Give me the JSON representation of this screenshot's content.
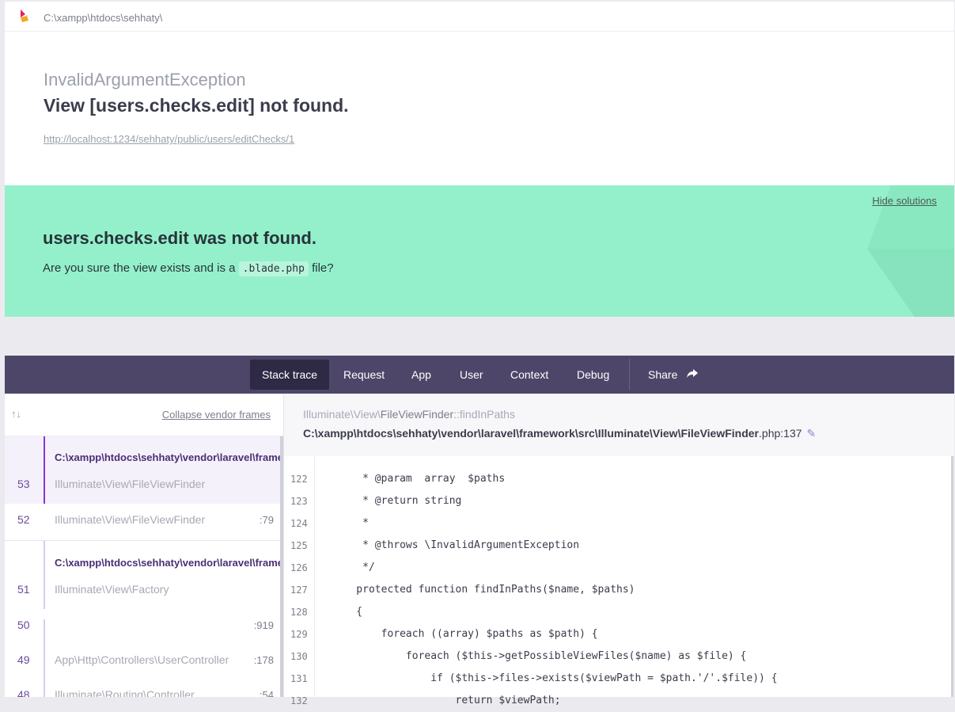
{
  "header": {
    "path": "C:\\xampp\\htdocs\\sehhaty\\"
  },
  "error": {
    "exception_class": "InvalidArgumentException",
    "message": "View [users.checks.edit] not found.",
    "url": "http://localhost:1234/sehhaty/public/users/editChecks/1"
  },
  "solution": {
    "hide_label": "Hide solutions",
    "title": "users.checks.edit was not found.",
    "desc_before": "Are you sure the view exists and is a",
    "desc_code": ".blade.php",
    "desc_after": "file?"
  },
  "tabs": [
    "Stack trace",
    "Request",
    "App",
    "User",
    "Context",
    "Debug",
    "Share"
  ],
  "frames_header": {
    "collapse_label": "Collapse vendor frames",
    "arrows": "↑↓"
  },
  "frames": [
    {
      "file": "C:\\xampp\\htdocs\\sehhaty\\vendor\\laravel\\framework\\src\\Illuminate\\View\\FileViewFinder.php",
      "num": "53",
      "cls": "Illuminate\\View\\FileViewFinder",
      "line": ""
    },
    {
      "file": "",
      "num": "52",
      "cls": "Illuminate\\View\\FileViewFinder",
      "line": ":79"
    },
    {
      "file": "C:\\xampp\\htdocs\\sehhaty\\vendor\\laravel\\framework\\src\\Illuminate\\View\\Factory.php",
      "num": "51",
      "cls": "Illuminate\\View\\Factory",
      "line": ""
    },
    {
      "file": "",
      "num": "50",
      "cls": "",
      "line": ":919"
    },
    {
      "file": "",
      "num": "49",
      "cls": "App\\Http\\Controllers\\UserController",
      "line": ":178"
    },
    {
      "file": "",
      "num": "48",
      "cls": "Illuminate\\Routing\\Controller",
      "line": ":54"
    }
  ],
  "detail": {
    "class_prefix": "Illuminate\\View\\",
    "class_name": "FileViewFinder",
    "method": "::findInPaths",
    "file": "C:\\xampp\\htdocs\\sehhaty\\vendor\\laravel\\framework\\src\\Illuminate\\View\\FileViewFinder",
    "file_ext": ".php:137"
  },
  "code_lines": [
    {
      "ln": "122",
      "src": "     * @param  array  $paths"
    },
    {
      "ln": "123",
      "src": "     * @return string"
    },
    {
      "ln": "124",
      "src": "     *"
    },
    {
      "ln": "125",
      "src": "     * @throws \\InvalidArgumentException"
    },
    {
      "ln": "126",
      "src": "     */"
    },
    {
      "ln": "127",
      "src": "    protected function findInPaths($name, $paths)"
    },
    {
      "ln": "128",
      "src": "    {"
    },
    {
      "ln": "129",
      "src": "        foreach ((array) $paths as $path) {"
    },
    {
      "ln": "130",
      "src": "            foreach ($this->getPossibleViewFiles($name) as $file) {"
    },
    {
      "ln": "131",
      "src": "                if ($this->files->exists($viewPath = $path.'/'.$file)) {"
    },
    {
      "ln": "132",
      "src": "                    return $viewPath;"
    }
  ]
}
